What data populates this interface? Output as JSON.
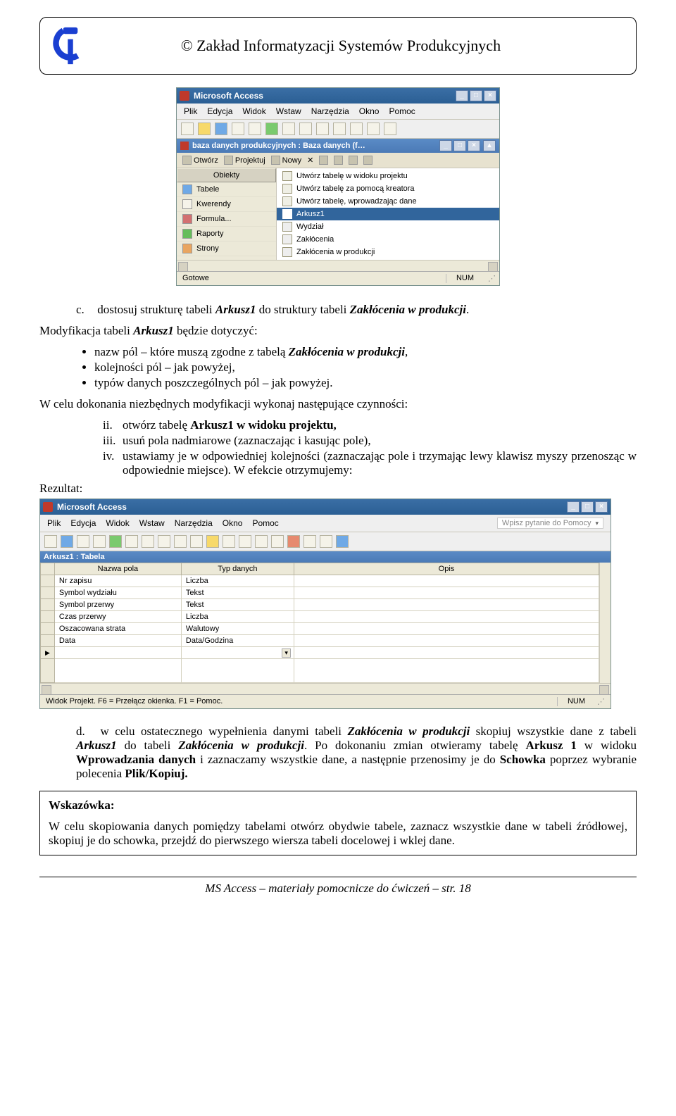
{
  "header": {
    "title": "© Zakład Informatyzacji Systemów Produkcyjnych"
  },
  "screenshot1": {
    "title": "Microsoft Access",
    "menu": [
      "Plik",
      "Edycja",
      "Widok",
      "Wstaw",
      "Narzędzia",
      "Okno",
      "Pomoc"
    ],
    "db_title": "baza danych produkcyjnych : Baza danych (f…",
    "db_tools": [
      "Otwórz",
      "Projektuj",
      "Nowy"
    ],
    "obj_header": "Obiekty",
    "objects": [
      "Tabele",
      "Kwerendy",
      "Formula...",
      "Raporty",
      "Strony"
    ],
    "list": [
      "Utwórz tabelę w widoku projektu",
      "Utwórz tabelę za pomocą kreatora",
      "Utwórz tabelę, wprowadzając dane",
      "Arkusz1",
      "Wydział",
      "Zakłócenia",
      "Zakłócenia w produkcji"
    ],
    "status_left": "Gotowe",
    "status_num": "NUM"
  },
  "body": {
    "c_text_pre": "dostosuj strukturę tabeli ",
    "c_text_mid": " do struktury tabeli ",
    "c_text_end": ".",
    "arkusz1": "Arkusz1",
    "zaklocenia": "Zakłócenia w produkcji",
    "mod_pre": "Modyfikacja tabeli ",
    "mod_post": " będzie dotyczyć:",
    "bullet1_pre": "nazw pól – które muszą zgodne z tabelą ",
    "bullet1_post": ",",
    "bullet2": "kolejności pól – jak powyżej,",
    "bullet3": "typów danych poszczególnych pól – jak powyżej.",
    "wcelu": "W celu dokonania niezbędnych modyfikacji wykonaj następujące czynności:",
    "ii_pre": "otwórz tabelę ",
    "ii_bold": "Arkusz1 w widoku projektu,",
    "iii": "usuń pola nadmiarowe (zaznaczając i kasując pole),",
    "iv": "ustawiamy je w odpowiedniej kolejności (zaznaczając pole i trzymając lewy klawisz myszy przenosząc w odpowiednie miejsce). W efekcie otrzymujemy:",
    "rezultat": "Rezultat:"
  },
  "screenshot2": {
    "title": "Microsoft Access",
    "menu": [
      "Plik",
      "Edycja",
      "Widok",
      "Wstaw",
      "Narzędzia",
      "Okno",
      "Pomoc"
    ],
    "help_placeholder": "Wpisz pytanie do Pomocy",
    "inner_title": "Arkusz1 : Tabela",
    "col1": "Nazwa pola",
    "col2": "Typ danych",
    "col3": "Opis",
    "rows": [
      {
        "name": "Nr zapisu",
        "type": "Liczba"
      },
      {
        "name": "Symbol wydziału",
        "type": "Tekst"
      },
      {
        "name": "Symbol przerwy",
        "type": "Tekst"
      },
      {
        "name": "Czas przerwy",
        "type": "Liczba"
      },
      {
        "name": "Oszacowana strata",
        "type": "Walutowy"
      },
      {
        "name": "Data",
        "type": "Data/Godzina"
      }
    ],
    "status_left": "Widok Projekt. F6 = Przełącz okienka. F1 = Pomoc.",
    "status_num": "NUM"
  },
  "d_text": {
    "pre": "w celu ostatecznego wypełnienia danymi tabeli ",
    "m1": " skopiuj wszystkie dane z tabeli ",
    "m2": " do tabeli ",
    "m3": ". Po dokonaniu zmian otwieramy tabelę ",
    "ark1b": "Arkusz 1",
    "m4": " w widoku ",
    "wprow": "Wprowadzania danych",
    "m5": " i zaznaczamy wszystkie dane, a następnie przenosimy je do ",
    "schowka": "Schowka",
    "m6": " poprzez wybranie polecenia ",
    "plikkop": "Plik/Kopiuj."
  },
  "hint": {
    "title": "Wskazówka:",
    "text": "W celu skopiowania danych pomiędzy tabelami otwórz obydwie tabele, zaznacz wszystkie dane w tabeli źródłowej, skopiuj je do schowka, przejdź do pierwszego wiersza tabeli docelowej i wklej dane."
  },
  "footer": {
    "text_pre": "MS Access",
    "text_post": " – materiały pomocnicze do ćwiczeń – str. 18"
  }
}
